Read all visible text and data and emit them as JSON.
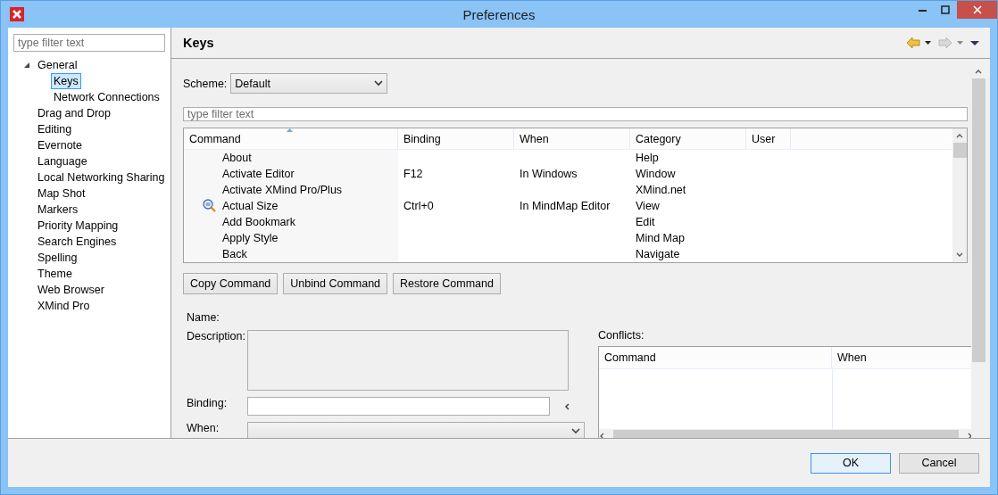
{
  "window": {
    "title": "Preferences"
  },
  "sidebar": {
    "filter": {
      "placeholder": "type filter text"
    },
    "items": [
      {
        "label": "General",
        "expanded": true,
        "selected": false,
        "children": [
          {
            "label": "Keys",
            "selected": true
          },
          {
            "label": "Network Connections",
            "selected": false
          }
        ]
      },
      {
        "label": "Drag and Drop",
        "selected": false
      },
      {
        "label": "Editing",
        "selected": false
      },
      {
        "label": "Evernote",
        "selected": false
      },
      {
        "label": "Language",
        "selected": false
      },
      {
        "label": "Local Networking Sharing",
        "selected": false
      },
      {
        "label": "Map Shot",
        "selected": false
      },
      {
        "label": "Markers",
        "selected": false
      },
      {
        "label": "Priority Mapping",
        "selected": false
      },
      {
        "label": "Search Engines",
        "selected": false
      },
      {
        "label": "Spelling",
        "selected": false
      },
      {
        "label": "Theme",
        "selected": false
      },
      {
        "label": "Web Browser",
        "selected": false
      },
      {
        "label": "XMind Pro",
        "selected": false
      }
    ]
  },
  "page": {
    "title": "Keys",
    "nav": [
      {
        "kind": "back",
        "disabled": false
      },
      {
        "kind": "forward",
        "disabled": true
      }
    ],
    "scheme": {
      "label": "Scheme:",
      "value": "Default"
    },
    "filter": {
      "placeholder": "type filter text"
    },
    "table": {
      "columns": [
        {
          "label": "Command",
          "sorted": true
        },
        {
          "label": "Binding",
          "sorted": false
        },
        {
          "label": "When",
          "sorted": false
        },
        {
          "label": "Category",
          "sorted": false
        },
        {
          "label": "User",
          "sorted": false
        }
      ],
      "rows": [
        {
          "has_icon": false,
          "cells": [
            "About",
            "",
            "",
            "Help",
            ""
          ]
        },
        {
          "has_icon": false,
          "cells": [
            "Activate Editor",
            "F12",
            "In Windows",
            "Window",
            ""
          ]
        },
        {
          "has_icon": false,
          "cells": [
            "Activate XMind Pro/Plus",
            "",
            "",
            "XMind.net",
            ""
          ]
        },
        {
          "has_icon": true,
          "cells": [
            "Actual Size",
            "Ctrl+0",
            "In MindMap Editor",
            "View",
            ""
          ]
        },
        {
          "has_icon": false,
          "cells": [
            "Add Bookmark",
            "",
            "",
            "Edit",
            ""
          ]
        },
        {
          "has_icon": false,
          "cells": [
            "Apply Style",
            "",
            "",
            "Mind Map",
            ""
          ]
        },
        {
          "has_icon": false,
          "cells": [
            "Back",
            "",
            "",
            "Navigate",
            ""
          ]
        }
      ]
    },
    "buttons": [
      "Copy Command",
      "Unbind Command",
      "Restore Command"
    ],
    "details": {
      "name_label": "Name:",
      "description_label": "Description:",
      "binding_label": "Binding:",
      "when_label": "When:"
    },
    "conflicts": {
      "label": "Conflicts:",
      "columns": [
        "Command",
        "When"
      ]
    }
  },
  "dialog_buttons": [
    {
      "label": "OK",
      "default": true
    },
    {
      "label": "Cancel",
      "default": false
    }
  ]
}
